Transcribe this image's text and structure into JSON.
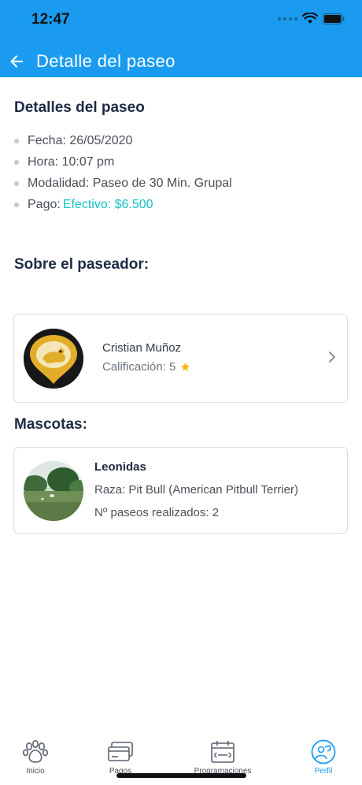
{
  "status_bar": {
    "time": "12:47"
  },
  "header": {
    "title": "Detalle del paseo"
  },
  "details": {
    "title": "Detalles del paseo",
    "fecha": "Fecha: 26/05/2020",
    "hora": "Hora: 10:07 pm",
    "modalidad": "Modalidad: Paseo de 30 Min. Grupal",
    "pago_label": "Pago:",
    "pago_value": "Efectivo: $6.500"
  },
  "walker": {
    "section_title": "Sobre el paseador:",
    "name": "Cristian Muñoz",
    "rating": "Calificación: 5"
  },
  "pets": {
    "section_title": "Mascotas:",
    "items": [
      {
        "name": "Leonidas",
        "breed": "Raza: Pit Bull (American Pitbull Terrier)",
        "walks": "Nº paseos realizados: 2"
      }
    ]
  },
  "tabbar": {
    "items": [
      {
        "label": "Inicio",
        "icon": "paw-icon"
      },
      {
        "label": "Pagos",
        "icon": "cards-icon"
      },
      {
        "label": "Programaciones",
        "icon": "calendar-bone-icon"
      },
      {
        "label": "Perfil",
        "icon": "profile-icon"
      }
    ],
    "active": "Perfil"
  },
  "colors": {
    "primary": "#1a9bf0",
    "accent": "#14c1c4",
    "star": "#f5b400",
    "text": "#1f2a44"
  }
}
